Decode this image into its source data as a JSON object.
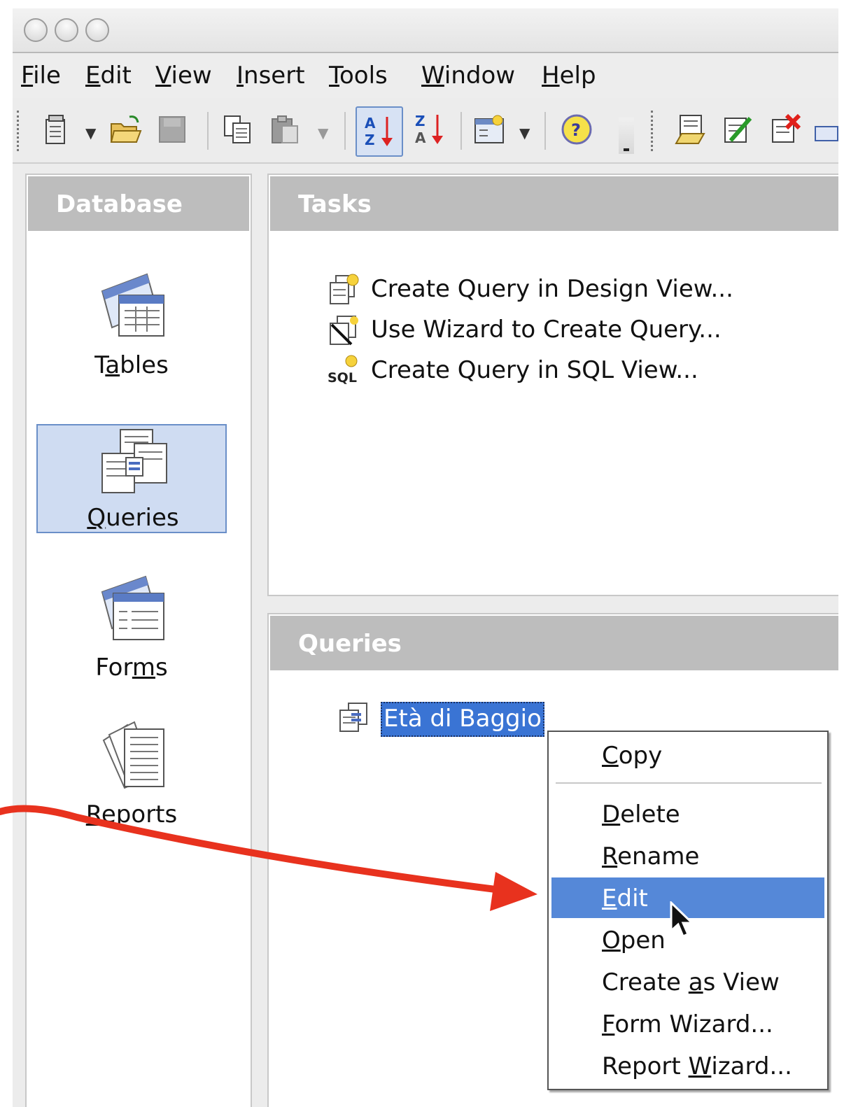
{
  "menubar": {
    "items": [
      {
        "pre": "",
        "key": "F",
        "post": "ile"
      },
      {
        "pre": "",
        "key": "E",
        "post": "dit"
      },
      {
        "pre": "",
        "key": "V",
        "post": "iew"
      },
      {
        "pre": "",
        "key": "I",
        "post": "nsert"
      },
      {
        "pre": "",
        "key": "T",
        "post": "ools"
      },
      {
        "pre": "",
        "key": "W",
        "post": "indow"
      },
      {
        "pre": "",
        "key": "H",
        "post": "elp"
      }
    ]
  },
  "toolbar": {
    "icons": [
      "new-document-icon",
      "open-folder-icon",
      "save-icon",
      "copy-icon",
      "paste-icon",
      "sort-ascending-icon",
      "sort-descending-icon",
      "form-design-icon",
      "help-icon",
      "new-query-icon",
      "edit-query-icon",
      "delete-query-icon"
    ],
    "sort_asc_top": "A",
    "sort_asc_bottom": "Z",
    "sort_desc_top": "Z",
    "sort_desc_bottom": "A"
  },
  "database": {
    "header": "Database",
    "categories": [
      {
        "pre": "T",
        "key": "a",
        "post": "bles",
        "icon": "tables-icon"
      },
      {
        "pre": "",
        "key": "Q",
        "post": "ueries",
        "icon": "queries-icon",
        "selected": true
      },
      {
        "pre": "For",
        "key": "m",
        "post": "s",
        "icon": "forms-icon"
      },
      {
        "pre": "",
        "key": "R",
        "post": "eports",
        "icon": "reports-icon"
      }
    ]
  },
  "tasks": {
    "header": "Tasks",
    "items": [
      {
        "label": "Create Query in Design View...",
        "icon": "design-view-icon"
      },
      {
        "label": "Use Wizard to Create Query...",
        "icon": "wizard-icon"
      },
      {
        "label": "Create Query in SQL View...",
        "icon": "sql-icon",
        "icon_text": "SQL"
      }
    ]
  },
  "queries": {
    "header": "Queries",
    "items": [
      {
        "label": "Età di Baggio",
        "icon": "query-icon",
        "selected": true
      }
    ]
  },
  "context_menu": {
    "items": [
      {
        "pre": "",
        "key": "C",
        "post": "opy"
      },
      {
        "pre": "",
        "key": "D",
        "post": "elete"
      },
      {
        "pre": "",
        "key": "R",
        "post": "ename"
      },
      {
        "pre": "",
        "key": "E",
        "post": "dit",
        "highlighted": true
      },
      {
        "pre": "",
        "key": "O",
        "post": "pen"
      },
      {
        "pre": "Create ",
        "key": "a",
        "post": "s View"
      },
      {
        "pre": "",
        "key": "F",
        "post": "orm Wizard..."
      },
      {
        "pre": "Report ",
        "key": "W",
        "post": "izard..."
      }
    ]
  },
  "colors": {
    "selection": "#3a74d4",
    "menu_highlight": "#5588d8",
    "panel_header": "#bdbdbd",
    "annotation_arrow": "#e8321e"
  }
}
